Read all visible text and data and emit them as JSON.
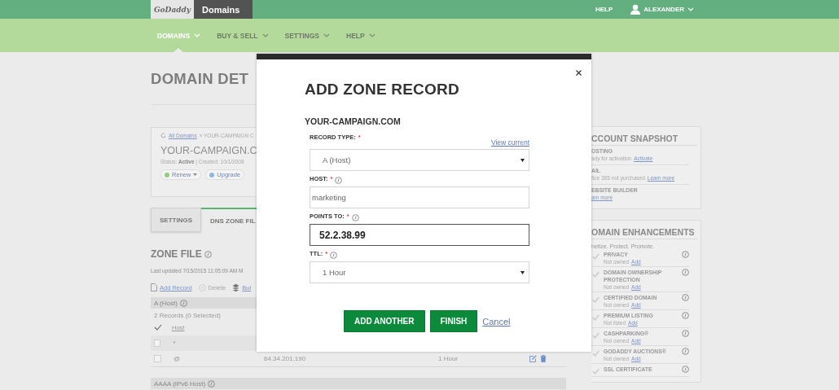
{
  "top_bar": {
    "logo": "GoDaddy",
    "product_menu": "Domains",
    "help": "HELP",
    "user": "ALEXANDER"
  },
  "nav": [
    {
      "label": "DOMAINS",
      "selected": true
    },
    {
      "label": "BUY & SELL",
      "selected": false
    },
    {
      "label": "SETTINGS",
      "selected": false
    },
    {
      "label": "HELP",
      "selected": false
    }
  ],
  "page": {
    "title": "DOMAIN DET",
    "breadcrumb": {
      "link": "All Domains",
      "rest": "» YOUR-CAMPAIGN C"
    },
    "domain": "YOUR-CAMPAIGN.C",
    "status": "Status: **Active**  |  Created: 10/1/2008",
    "actions": [
      {
        "label": "Renew",
        "caret": true
      },
      {
        "label": "Upgrade",
        "caret": false
      }
    ],
    "tabs": [
      {
        "label": "SETTINGS",
        "selected": false
      },
      {
        "label": "DNS ZONE FIL",
        "selected": true
      }
    ],
    "zone_file": {
      "title": "ZONE FILE",
      "last_updated": "Last updated 7/15/2015 11:05:09 AM M",
      "toolbar": [
        {
          "kind": "add",
          "label": "Add Record",
          "disabled": false
        },
        {
          "kind": "delete",
          "label": "Delete",
          "disabled": true
        },
        {
          "kind": "bulk",
          "label": "Bul",
          "disabled": false
        }
      ],
      "groups": [
        {
          "title": "A (Host)",
          "count": "2 Records (0 Selected)",
          "host_header": "Host",
          "rows": [
            {
              "host": "*",
              "checked": false
            },
            {
              "host": "@",
              "points_to": "64.34.201.190",
              "ttl": "1 Hour",
              "checked": false
            }
          ]
        },
        {
          "title": "AAAA (IPv6 Host)"
        }
      ]
    }
  },
  "sidebar": {
    "account_snapshot": {
      "title": "CCOUNT SNAPSHOT",
      "items": [
        {
          "name": "OSTING",
          "text": "ady for activation",
          "link": "Activate"
        },
        {
          "name": "AIL",
          "text": "fice 365 not purchased",
          "link": "Learn more"
        },
        {
          "name": "EBSITE BUILDER",
          "link": "arn more"
        }
      ]
    },
    "enhancements": {
      "title": "OMAIN ENHANCEMENTS",
      "tagline": "netize. Protect. Promote.",
      "items": [
        {
          "name": "PRIVACY",
          "status": "Not owned",
          "link": "Add"
        },
        {
          "name": "DOMAIN OWNERSHIP PROTECTION",
          "status": "Not owned",
          "link": "Add"
        },
        {
          "name": "CERTIFIED DOMAIN",
          "status": "Not owned",
          "link": "Add"
        },
        {
          "name": "PREMIUM LISTING",
          "status": "Not listed",
          "link": "Add"
        },
        {
          "name": "CASHPARKING®",
          "status": "Not owned",
          "link": "Add"
        },
        {
          "name": "GODADDY AUCTIONS®",
          "status": "Not owned",
          "link": "Add"
        },
        {
          "name": "SSL CERTIFICATE"
        }
      ]
    }
  },
  "modal": {
    "title": "ADD ZONE RECORD",
    "domain": "YOUR-CAMPAIGN.COM",
    "view_current": "View current",
    "fields": [
      {
        "kind": "select",
        "label": "RECORD TYPE:",
        "required_mark": "*",
        "info": false,
        "value": "A (Host)",
        "focused": false
      },
      {
        "kind": "text",
        "label": "HOST:",
        "required_mark": "*",
        "info": true,
        "value": "marketing",
        "focused": false
      },
      {
        "kind": "text",
        "label": "POINTS TO:",
        "required_mark": "*",
        "info": true,
        "value": "52.2.38.99",
        "focused": true
      },
      {
        "kind": "select",
        "label": "TTL:",
        "required_mark": "*",
        "info": true,
        "value": "1 Hour",
        "focused": false
      }
    ],
    "buttons": [
      {
        "kind": "primary",
        "label": "ADD ANOTHER"
      },
      {
        "kind": "primary",
        "label": "FINISH"
      },
      {
        "kind": "link",
        "label": "Cancel"
      }
    ]
  }
}
